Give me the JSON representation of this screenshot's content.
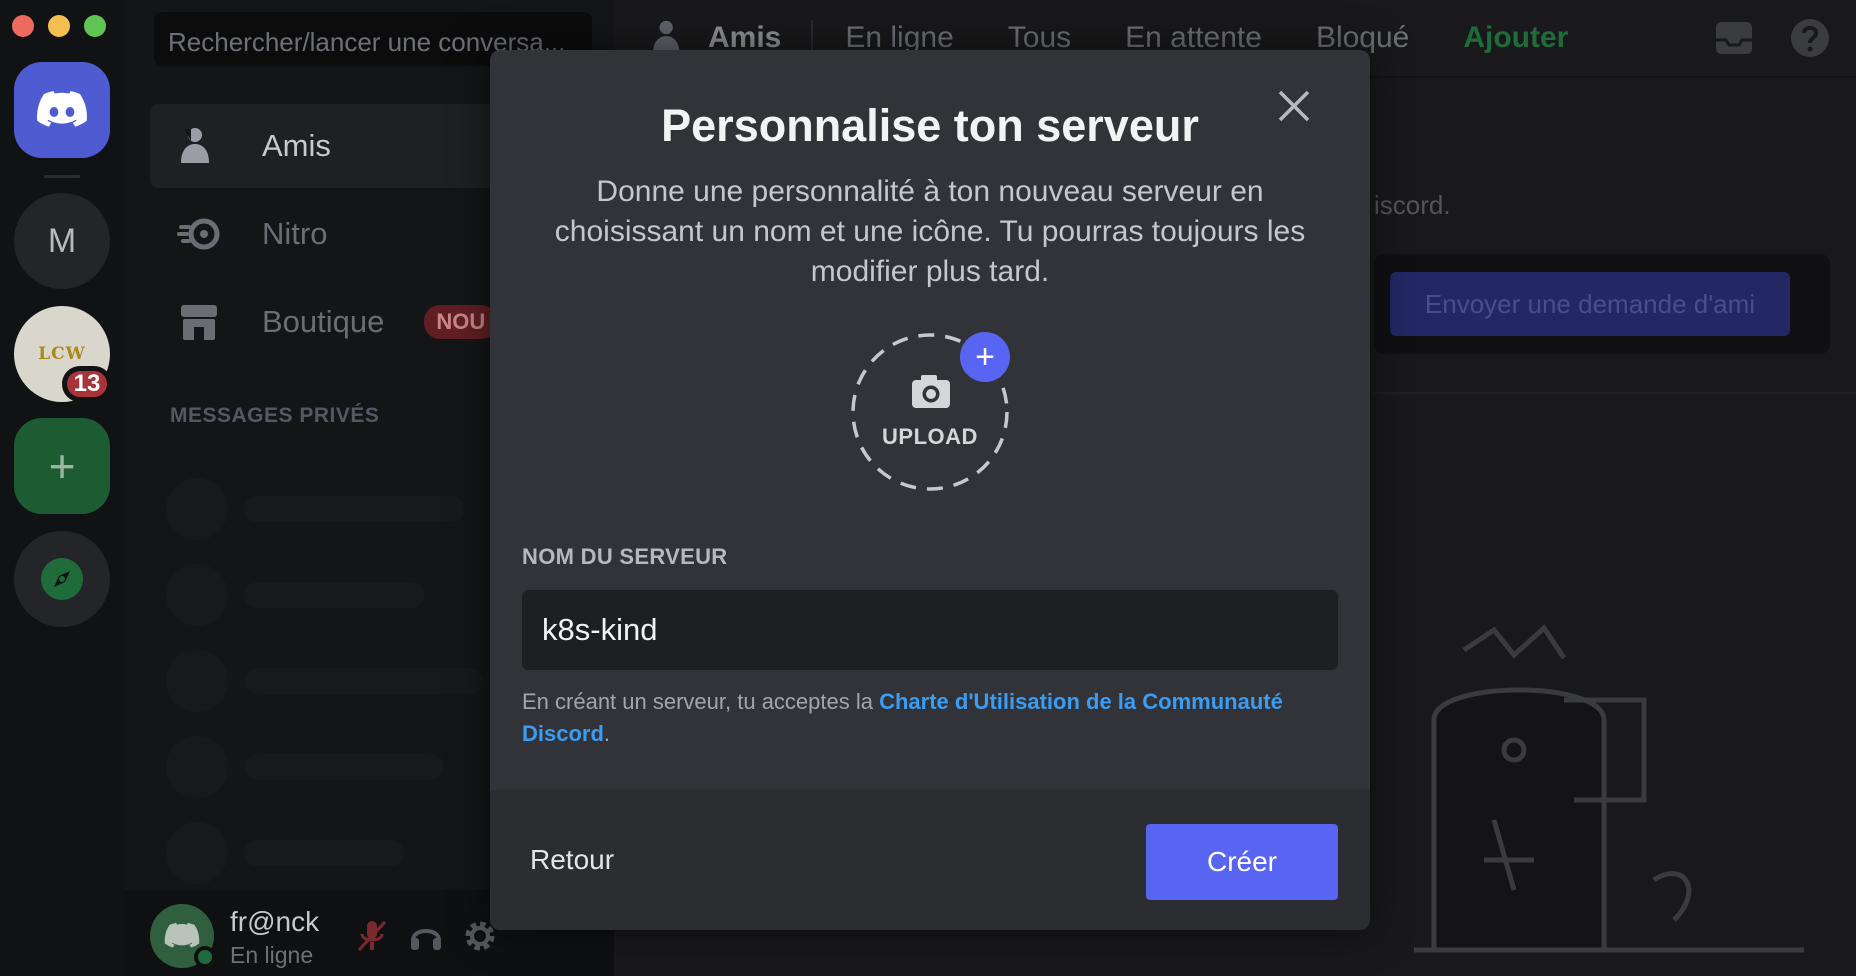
{
  "colors": {
    "close": "#ec6a5e",
    "minimize": "#f4bf4f",
    "zoom": "#61c554",
    "accent": "#5865f2",
    "link": "#3a9cf2"
  },
  "servers": {
    "monogram": "M",
    "lc_text": "LCW",
    "badge": "13",
    "add_glyph": "+"
  },
  "sidebar": {
    "search_placeholder": "Rechercher/lancer une conversa...",
    "items": [
      {
        "label": "Amis",
        "icon": "friends-icon"
      },
      {
        "label": "Nitro",
        "icon": "nitro-icon"
      },
      {
        "label": "Boutique",
        "icon": "shop-icon",
        "badge": "NOU"
      }
    ],
    "dm_header": "MESSAGES PRIVÉS"
  },
  "user": {
    "name": "fr@nck",
    "status": "En ligne"
  },
  "topbar": {
    "title": "Amis",
    "tabs": [
      "En ligne",
      "Tous",
      "En attente",
      "Bloqué"
    ],
    "add": "Ajouter"
  },
  "main": {
    "bg_text": "iscord.",
    "friend_request_button": "Envoyer une demande d'ami"
  },
  "modal": {
    "title": "Personnalise ton serveur",
    "description": "Donne une personnalité à ton nouveau serveur en choisissant un nom et une icône. Tu pourras toujours les modifier plus tard.",
    "upload_label": "UPLOAD",
    "field_label": "NOM DU SERVEUR",
    "server_name_value": "k8s-kind",
    "terms_prefix": "En créant un serveur, tu acceptes la ",
    "terms_link": "Charte d'Utilisation de la Communauté Discord",
    "terms_suffix": ".",
    "back_label": "Retour",
    "create_label": "Créer"
  }
}
